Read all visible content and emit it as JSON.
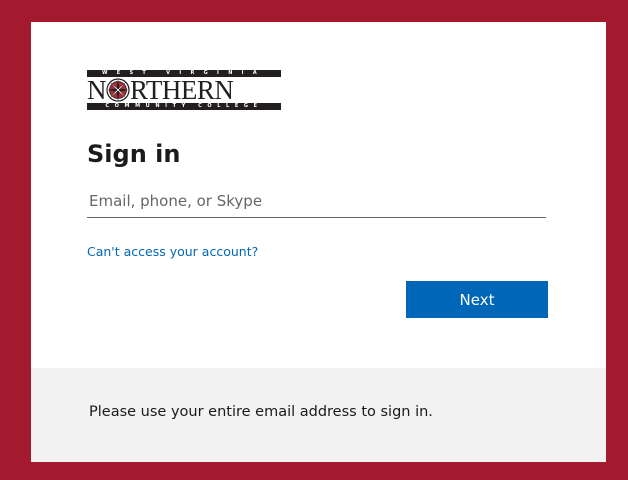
{
  "logo": {
    "top_band": "WEST VIRGINIA",
    "wordmark_first": "N",
    "wordmark_rest": "RTHERN",
    "bottom_band": "COMMUNITY COLLEGE"
  },
  "title": "Sign in",
  "email": {
    "value": "",
    "placeholder": "Email, phone, or Skype"
  },
  "help_link": "Can't access your account?",
  "next_label": "Next",
  "footer_text": "Please use your entire email address to sign in.",
  "colors": {
    "background": "#a31a2f",
    "accent": "#0067b8",
    "footer": "#f2f2f2"
  }
}
